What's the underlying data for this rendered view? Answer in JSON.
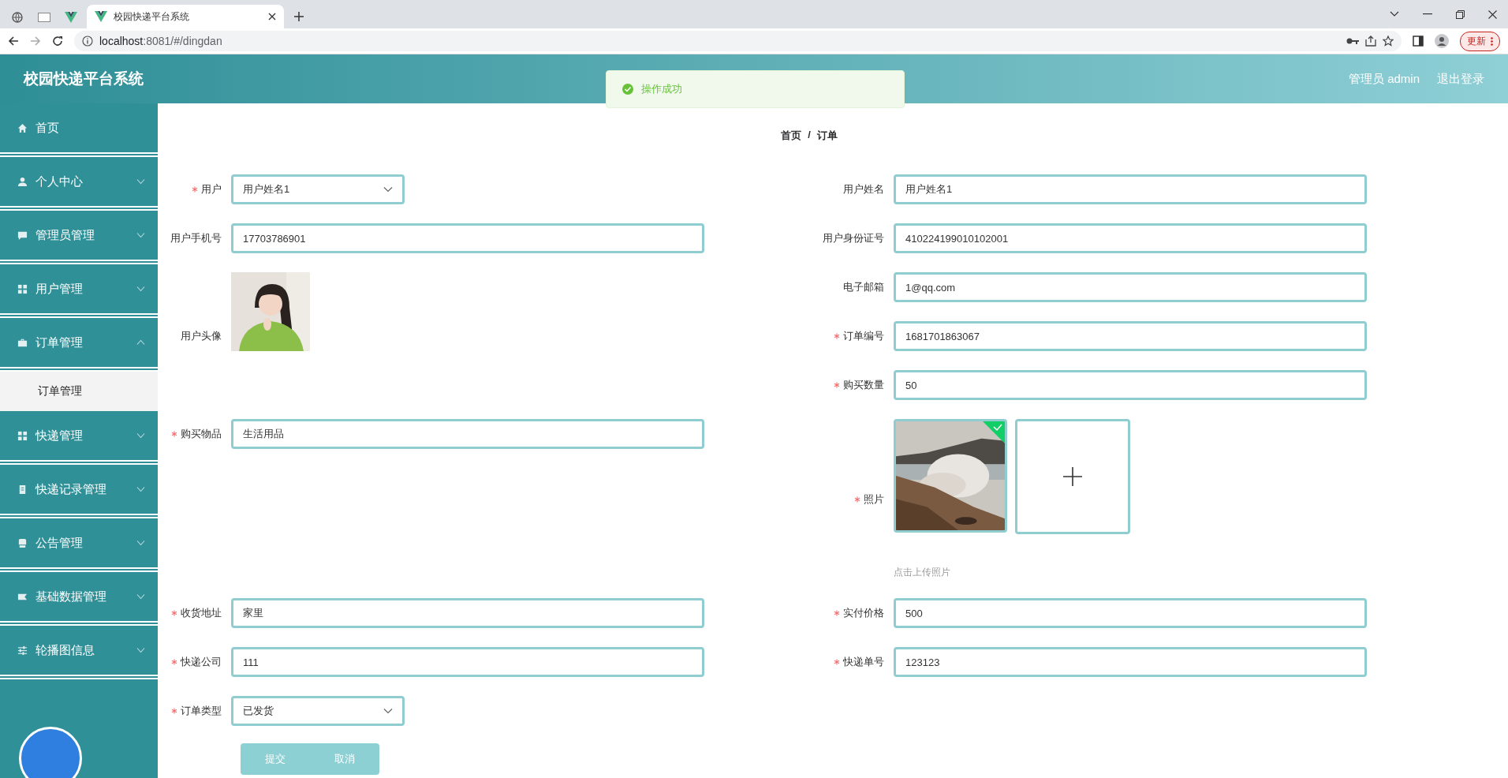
{
  "browser": {
    "tab_title": "校园快递平台系统",
    "url_host": "localhost",
    "url_rest": ":8081/#/dingdan",
    "update_button": "更新"
  },
  "header": {
    "title": "校园快递平台系统",
    "user": "管理员 admin",
    "logout": "退出登录"
  },
  "toast": {
    "message": "操作成功"
  },
  "sidebar": {
    "items": [
      {
        "label": "首页",
        "kind": "home",
        "expandable": false
      },
      {
        "label": "个人中心",
        "kind": "user",
        "expandable": true,
        "expanded": false
      },
      {
        "label": "管理员管理",
        "kind": "chat",
        "expandable": true,
        "expanded": false
      },
      {
        "label": "用户管理",
        "kind": "grid",
        "expandable": true,
        "expanded": false
      },
      {
        "label": "订单管理",
        "kind": "briefcase",
        "expandable": true,
        "expanded": true,
        "children": [
          {
            "label": "订单管理",
            "selected": true
          }
        ]
      },
      {
        "label": "快递管理",
        "kind": "grid",
        "expandable": true,
        "expanded": false
      },
      {
        "label": "快递记录管理",
        "kind": "clipboard",
        "expandable": true,
        "expanded": false
      },
      {
        "label": "公告管理",
        "kind": "printer",
        "expandable": true,
        "expanded": false
      },
      {
        "label": "基础数据管理",
        "kind": "ticket",
        "expandable": true,
        "expanded": false
      },
      {
        "label": "轮播图信息",
        "kind": "sliders",
        "expandable": true,
        "expanded": false
      }
    ]
  },
  "breadcrumb": {
    "items": [
      "首页",
      "订单"
    ],
    "separator": "/"
  },
  "form": {
    "rows": [
      {
        "left": {
          "kind": "select",
          "label": "用户",
          "required": true,
          "value": "用户姓名1"
        },
        "right": {
          "kind": "text",
          "label": "用户姓名",
          "required": false,
          "value": "用户姓名1"
        }
      },
      {
        "left": {
          "kind": "text",
          "label": "用户手机号",
          "required": false,
          "value": "17703786901"
        },
        "right": {
          "kind": "text",
          "label": "用户身份证号",
          "required": false,
          "value": "410224199010102001"
        }
      },
      {
        "left": {
          "label": "用户头像",
          "required": false
        },
        "right": {
          "kind": "text",
          "label": "电子邮箱",
          "required": false,
          "value": "1@qq.com"
        }
      },
      {
        "right": {
          "kind": "text",
          "label": "订单编号",
          "required": true,
          "value": "1681701863067"
        }
      },
      {
        "right": {
          "kind": "text",
          "label": "购买数量",
          "required": true,
          "value": "50"
        }
      },
      {
        "left": {
          "kind": "text",
          "label": "购买物品",
          "required": true,
          "value": "生活用品"
        },
        "right": {
          "kind": "upload",
          "label": "照片",
          "required": true,
          "hint": "点击上传照片",
          "files": [
            {
              "kind": "picture",
              "uploaded": true
            }
          ]
        }
      },
      {
        "left": {
          "kind": "text",
          "label": "收货地址",
          "required": true,
          "value": "家里"
        },
        "right": {
          "kind": "text",
          "label": "实付价格",
          "required": true,
          "value": "500"
        }
      },
      {
        "left": {
          "kind": "text",
          "label": "快递公司",
          "required": true,
          "value": "111"
        },
        "right": {
          "kind": "text",
          "label": "快递单号",
          "required": true,
          "value": "123123"
        }
      },
      {
        "left": {
          "kind": "select",
          "label": "订单类型",
          "required": true,
          "value": "已发货"
        }
      }
    ],
    "buttons": [
      {
        "label": "提交",
        "kind": "submit"
      },
      {
        "label": "取消",
        "kind": "cancel"
      }
    ]
  }
}
